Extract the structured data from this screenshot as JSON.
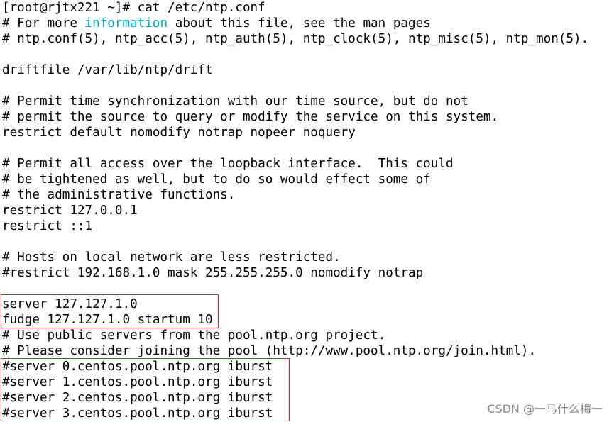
{
  "terminal": {
    "lines": [
      "[root@rjtx221 ~]# cat /etc/ntp.conf",
      "# For more ",
      "# ntp.conf(5), ntp_acc(5), ntp_auth(5), ntp_clock(5), ntp_misc(5), ntp_mon(5).",
      "",
      "driftfile /var/lib/ntp/drift",
      "",
      "# Permit time synchronization with our time source, but do not",
      "# permit the source to query or modify the service on this system.",
      "restrict default nomodify notrap nopeer noquery",
      "",
      "# Permit all access over the loopback interface.  This could",
      "# be tightened as well, but to do so would effect some of",
      "# the administrative functions.",
      "restrict 127.0.0.1",
      "restrict ::1",
      "",
      "# Hosts on local network are less restricted.",
      "#restrict 192.168.1.0 mask 255.255.255.0 nomodify notrap",
      "",
      "server 127.127.1.0",
      "fudge 127.127.1.0 startum 10",
      "# Use public servers from the pool.ntp.org project.",
      "# Please consider joining the pool (http://www.pool.ntp.org/join.html).",
      "#server 0.centos.pool.ntp.org iburst",
      "#server 1.centos.pool.ntp.org iburst",
      "#server 2.centos.pool.ntp.org iburst",
      "#server 3.centos.pool.ntp.org iburst"
    ],
    "line1_highlight": "information",
    "line1_rest": " about this file, see the man pages",
    "highlight_color": "#00aac8",
    "box_color": "#e02020"
  },
  "watermark": "CSDN @一马什么梅一"
}
